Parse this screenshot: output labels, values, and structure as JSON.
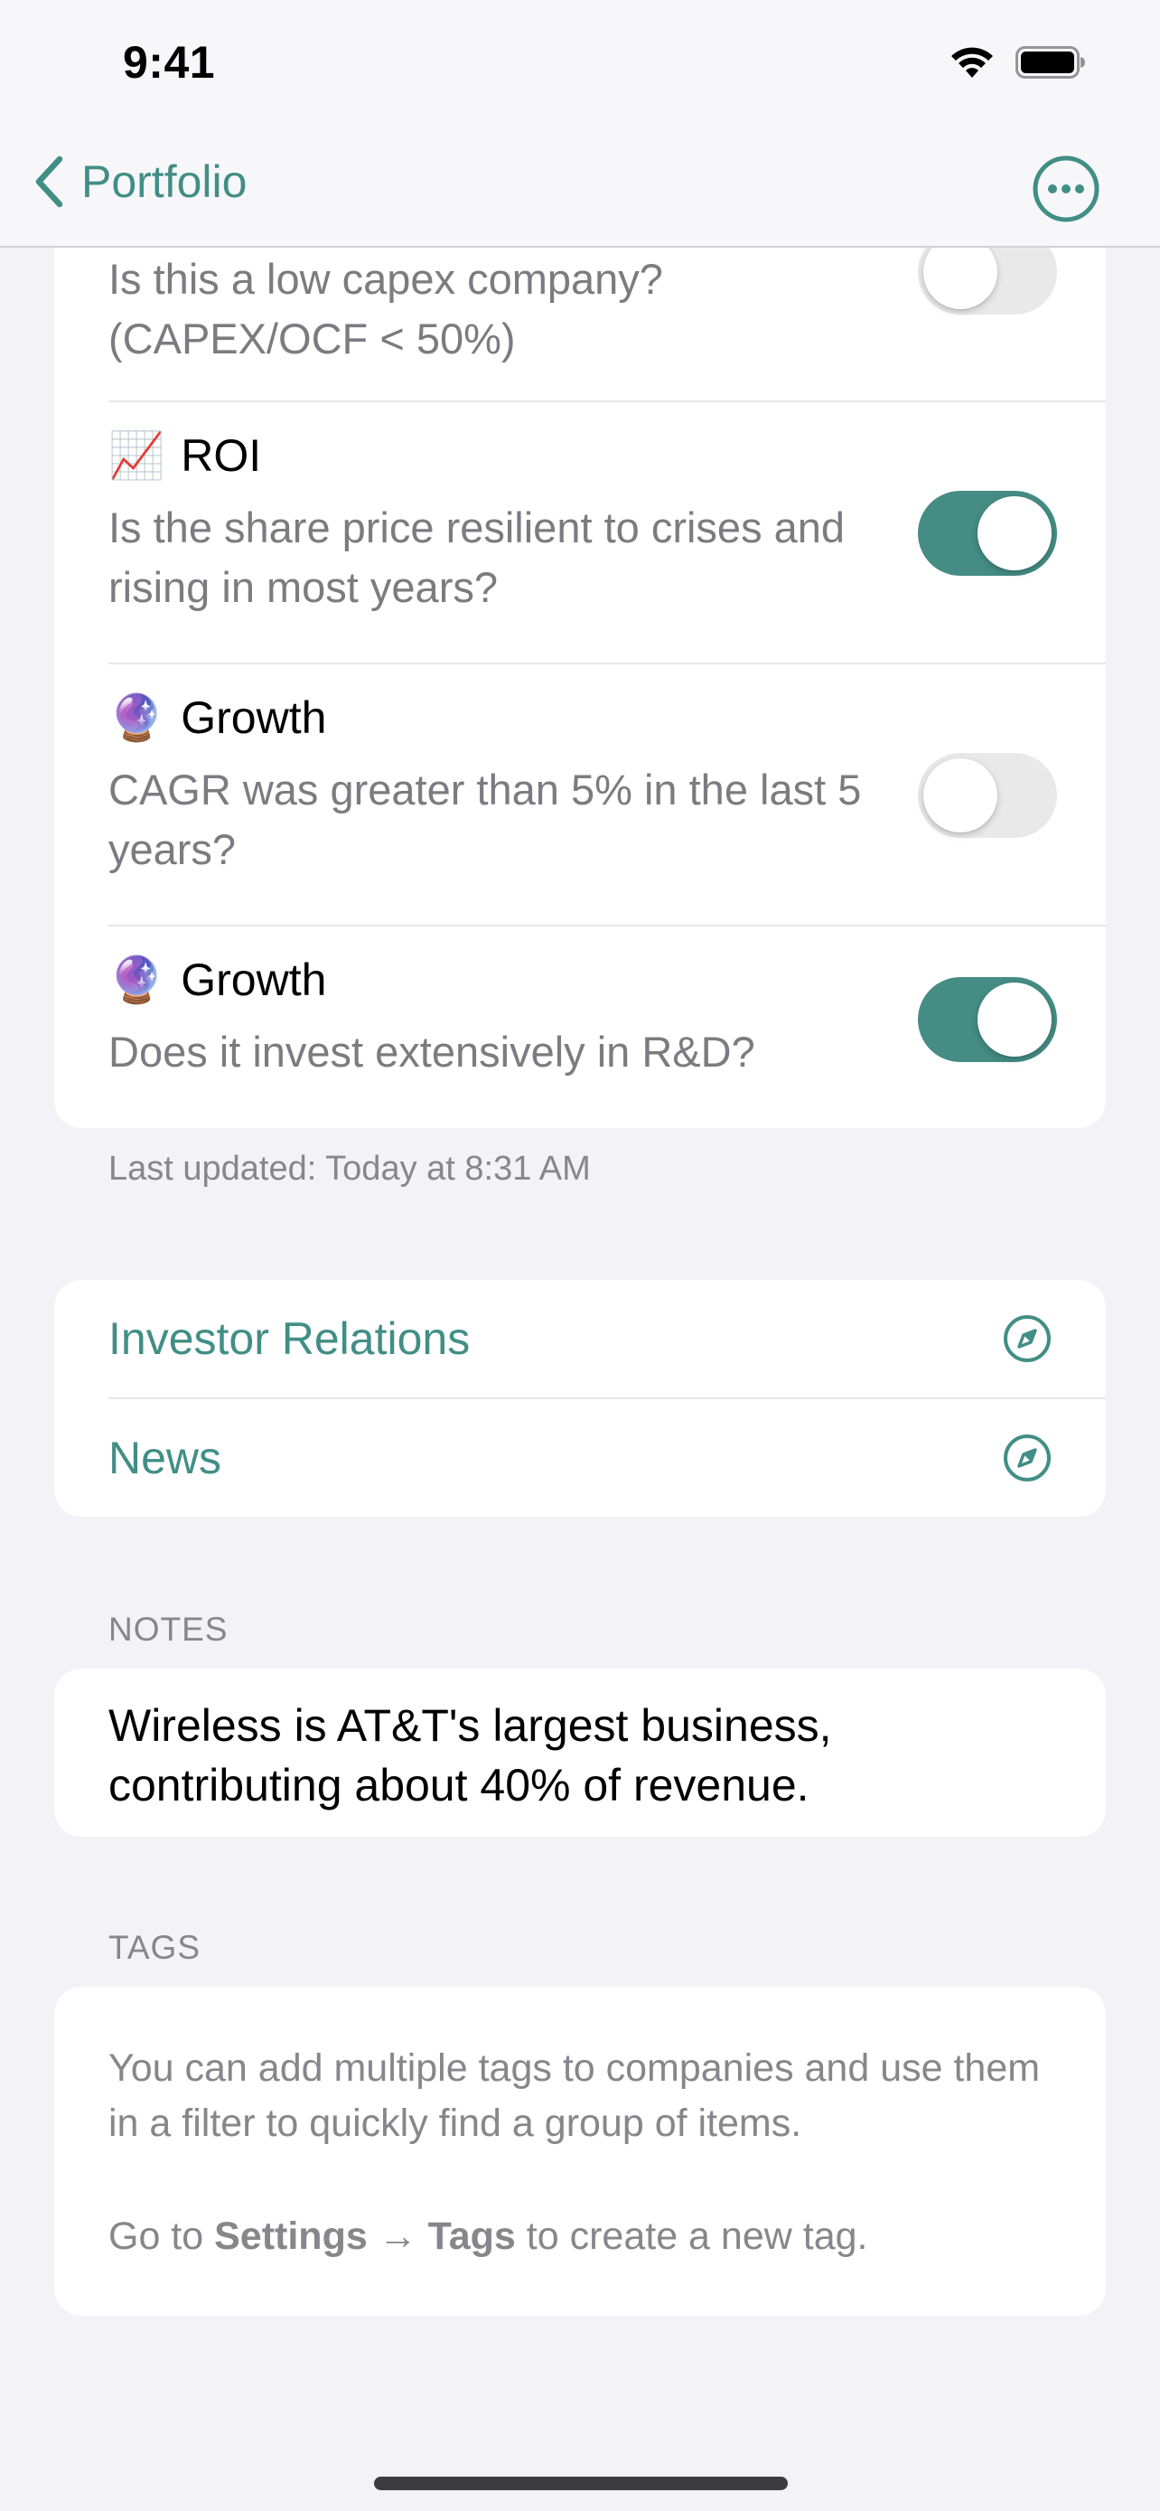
{
  "status_bar": {
    "time": "9:41"
  },
  "nav": {
    "back_label": "Portfolio"
  },
  "criteria": [
    {
      "emoji": "",
      "title": "",
      "subtitle": "Is this a low capex company? (CAPEX/OCF < 50%)",
      "enabled": false
    },
    {
      "emoji": "📈",
      "title": "ROI",
      "subtitle": "Is the share price resilient to crises and rising in most years?",
      "enabled": true
    },
    {
      "emoji": "🔮",
      "title": "Growth",
      "subtitle": "CAGR was greater than 5% in the last 5 years?",
      "enabled": false
    },
    {
      "emoji": "🔮",
      "title": "Growth",
      "subtitle": "Does it invest extensively in R&D?",
      "enabled": true
    }
  ],
  "last_updated": "Last updated: Today at 8:31 AM",
  "links": [
    {
      "label": "Investor Relations",
      "icon": "compass-icon"
    },
    {
      "label": "News",
      "icon": "compass-icon"
    }
  ],
  "notes": {
    "header": "NOTES",
    "text": "Wireless is AT&T's largest business, contributing about 40% of revenue."
  },
  "tags": {
    "header": "TAGS",
    "description": "You can add multiple tags to companies and use them in a filter to quickly find a group of items.",
    "hint_prefix": "Go to ",
    "hint_settings": "Settings",
    "hint_arrow": " → ",
    "hint_tags": "Tags",
    "hint_suffix": " to create a new tag."
  },
  "colors": {
    "accent": "#418e86",
    "toggle_on": "#448c84",
    "background": "#f2f2f7"
  }
}
